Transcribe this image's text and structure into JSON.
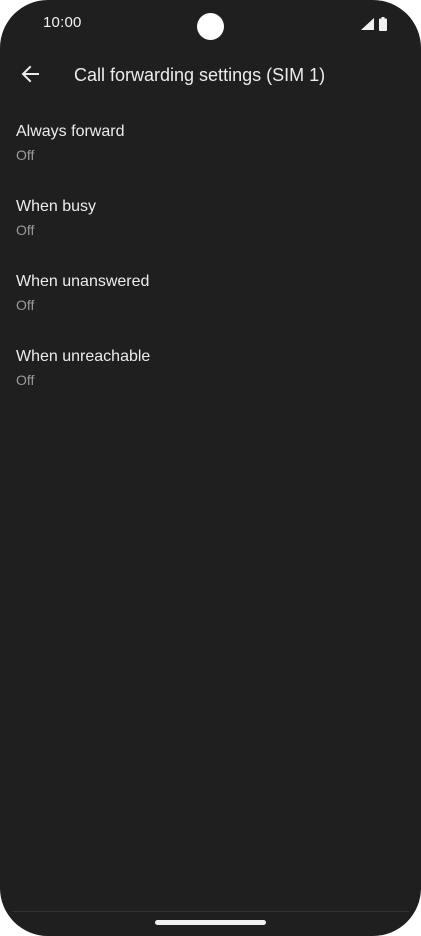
{
  "status_bar": {
    "time": "10:00",
    "icons": [
      "signal-icon",
      "battery-icon"
    ]
  },
  "app_bar": {
    "back_icon": "arrow-back-icon",
    "title": "Call forwarding settings (SIM 1)"
  },
  "settings": {
    "items": [
      {
        "title": "Always forward",
        "summary": "Off"
      },
      {
        "title": "When busy",
        "summary": "Off"
      },
      {
        "title": "When unanswered",
        "summary": "Off"
      },
      {
        "title": "When unreachable",
        "summary": "Off"
      }
    ]
  },
  "colors": {
    "background": "#1f1f1f",
    "primary_text": "#ececec",
    "secondary_text": "#9a9a9a"
  }
}
